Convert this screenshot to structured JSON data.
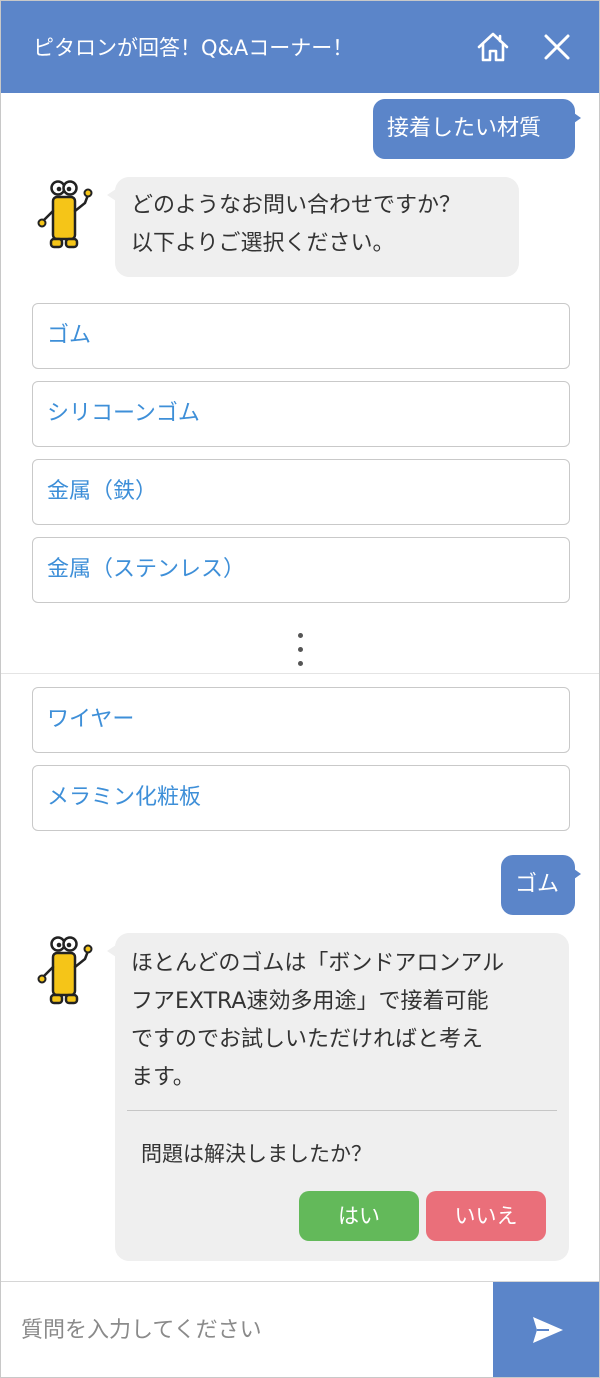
{
  "header": {
    "title": "ピタロンが回答！Q&Aコーナー！"
  },
  "icons": {
    "home": "home-icon",
    "close": "close-icon",
    "send": "send-icon",
    "bot": "bot-mascot"
  },
  "colors": {
    "header_bg": "#5b85c9",
    "user_bubble": "#5b85c9",
    "bot_bubble": "#efefef",
    "option_text": "#3e8fd8",
    "yes_button": "#63b95a",
    "no_button": "#ea6f7a",
    "mascot_yellow": "#f5c518"
  },
  "messages": {
    "user_1": "接着したい材質",
    "bot_1_line1": "どのようなお問い合わせですか？",
    "bot_1_line2": "以下よりご選択ください。",
    "user_2": "ゴム",
    "bot_2_line1": "ほとんどのゴムは「ボンドアロンアル",
    "bot_2_line2": "フアEXTRA速効多用途」で接着可能",
    "bot_2_line3": "ですのでお試しいただければと考え",
    "bot_2_line4": "ます。"
  },
  "options": {
    "items": [
      "ゴム",
      "シリコーンゴム",
      "金属（鉄）",
      "金属（ステンレス）",
      "ワイヤー",
      "メラミン化粧板"
    ]
  },
  "resolution": {
    "question": "問題は解決しましたか？",
    "yes_label": "はい",
    "no_label": "いいえ"
  },
  "input": {
    "placeholder": "質問を入力してください",
    "value": ""
  }
}
